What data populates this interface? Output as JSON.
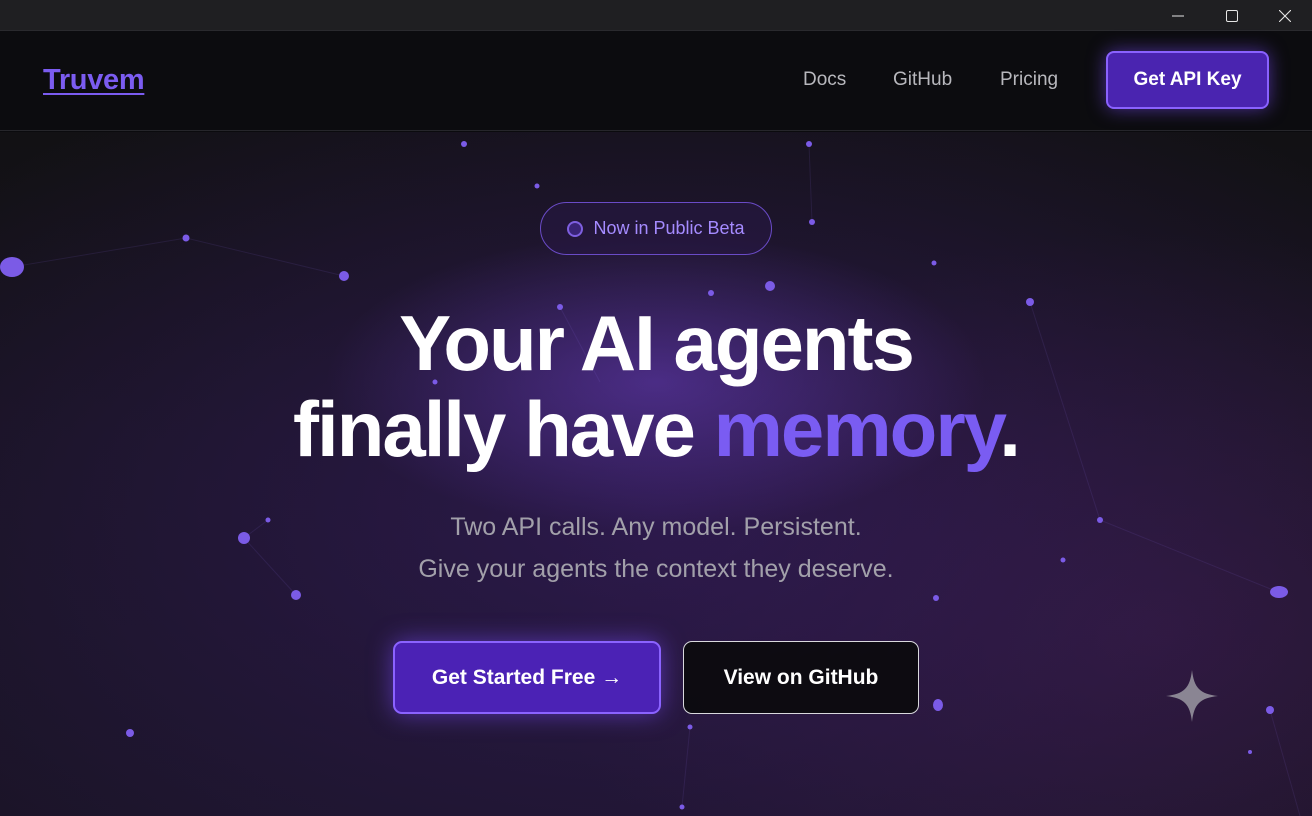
{
  "window": {
    "controls": {
      "minimize_icon": "minimize-icon",
      "maximize_icon": "maximize-icon",
      "close_icon": "close-icon"
    }
  },
  "navbar": {
    "brand": "Truvem",
    "links": [
      {
        "label": "Docs"
      },
      {
        "label": "GitHub"
      },
      {
        "label": "Pricing"
      }
    ],
    "cta_label": "Get API Key"
  },
  "hero": {
    "badge": "Now in Public Beta",
    "headline_line1": "Your AI agents",
    "headline_line2_prefix": "finally have ",
    "headline_accent": "memory",
    "headline_suffix": ".",
    "subtitle_line1": "Two API calls. Any model. Persistent.",
    "subtitle_line2": "Give your agents the context they deserve.",
    "primary_cta": "Get Started Free →",
    "secondary_cta": "View on GitHub"
  },
  "colors": {
    "accent": "#7a5cf2",
    "button_primary": "#4b22b5",
    "background": "#0b0b0e"
  }
}
